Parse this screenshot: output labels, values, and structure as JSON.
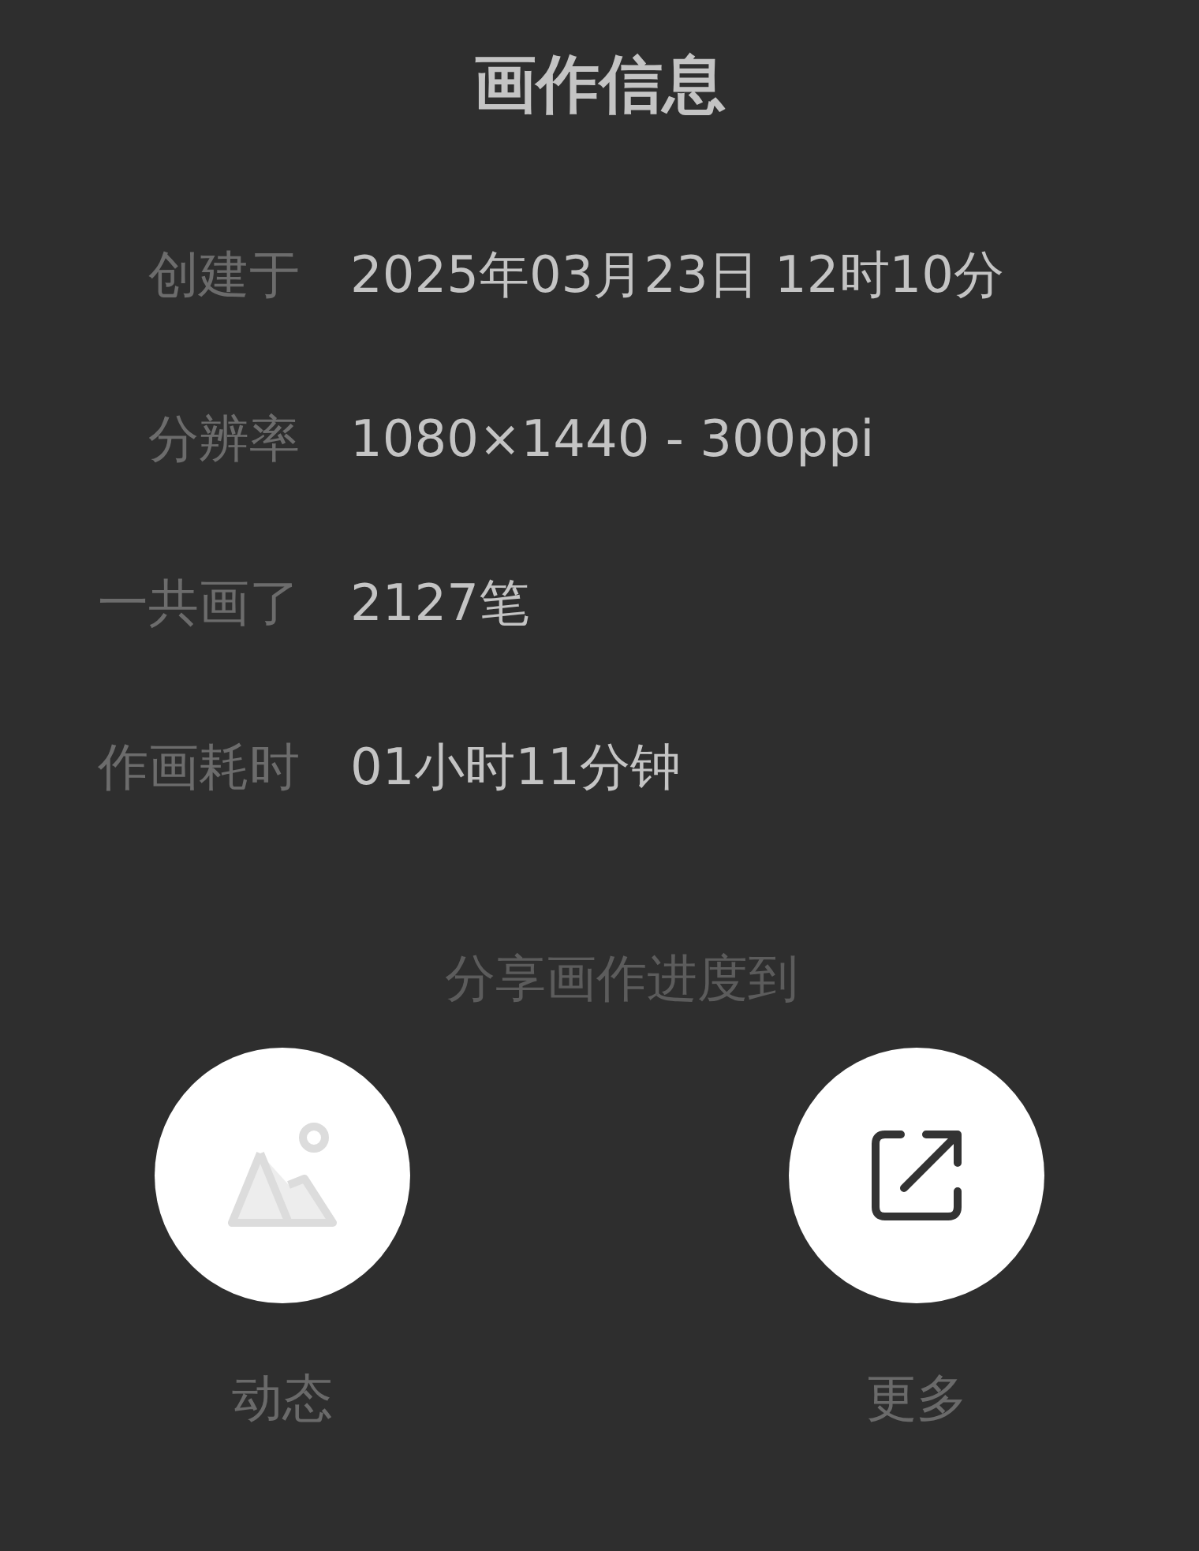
{
  "title": "画作信息",
  "info": [
    {
      "label": "创建于",
      "value": "2025年03月23日 12时10分"
    },
    {
      "label": "分辨率",
      "value": "1080×1440 - 300ppi"
    },
    {
      "label": "一共画了",
      "value": "2127笔"
    },
    {
      "label": "作画耗时",
      "value": "01小时11分钟"
    }
  ],
  "share": {
    "heading": "分享画作进度到",
    "targets": [
      {
        "kind": "image",
        "label": "动态",
        "disabled": true
      },
      {
        "kind": "share",
        "label": "更多",
        "disabled": false
      }
    ]
  }
}
